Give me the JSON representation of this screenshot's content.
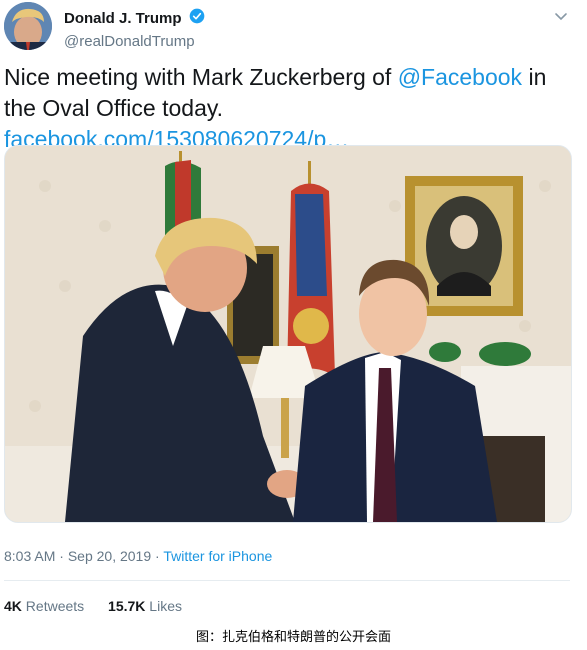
{
  "tweet": {
    "author": {
      "display_name": "Donald J. Trump",
      "handle": "@realDonaldTrump",
      "verified_icon": "verified-badge-icon"
    },
    "text": {
      "part1": "Nice meeting with Mark Zuckerberg of ",
      "mention": "@Facebook",
      "part2": " in the Oval Office today. ",
      "link": "facebook.com/153080620724/p…"
    },
    "photo": {
      "description": "Photo of two men shaking hands in the Oval Office"
    },
    "meta": {
      "time": "8:03 AM",
      "sep1": " · ",
      "date": "Sep 20, 2019",
      "sep2": " · ",
      "source": "Twitter for iPhone"
    },
    "stats": {
      "retweets_count": "4K",
      "retweets_label": " Retweets",
      "likes_count": "15.7K",
      "likes_label": " Likes"
    }
  },
  "caption": "图：扎克伯格和特朗普的公开会面",
  "colors": {
    "link": "#1b95e0",
    "secondary_text": "#657786",
    "primary_text": "#14171a"
  }
}
